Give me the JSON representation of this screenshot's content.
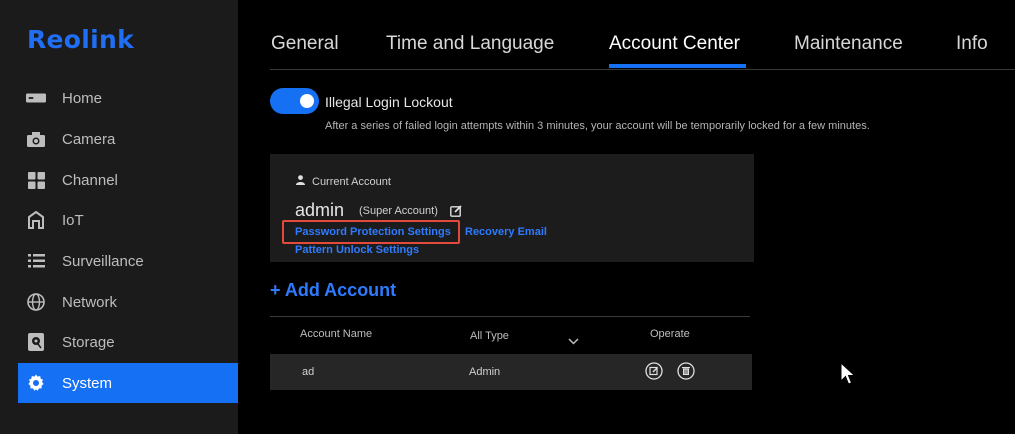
{
  "brand": {
    "logo": "Reolink",
    "accent": "#1670f4"
  },
  "sidebar": {
    "items": [
      {
        "label": "Home",
        "icon": "nvr-device-icon"
      },
      {
        "label": "Camera",
        "icon": "camera-icon"
      },
      {
        "label": "Channel",
        "icon": "grid-icon"
      },
      {
        "label": "IoT",
        "icon": "house-icon"
      },
      {
        "label": "Surveillance",
        "icon": "list-icon"
      },
      {
        "label": "Network",
        "icon": "globe-icon"
      },
      {
        "label": "Storage",
        "icon": "storage-icon"
      },
      {
        "label": "System",
        "icon": "gear-icon",
        "active": true
      }
    ]
  },
  "tabs": [
    {
      "label": "General"
    },
    {
      "label": "Time and Language"
    },
    {
      "label": "Account Center",
      "active": true
    },
    {
      "label": "Maintenance"
    },
    {
      "label": "Info"
    }
  ],
  "lockout": {
    "label": "Illegal Login Lockout",
    "enabled": true,
    "description": "After a series of failed login attempts within 3 minutes, your account will be temporarily locked for a few minutes."
  },
  "current_account": {
    "section_label": "Current Account",
    "name": "admin",
    "role": "(Super Account)",
    "links": {
      "password_protection": "Password Protection Settings",
      "recovery_email": "Recovery Email",
      "pattern_unlock": "Pattern Unlock Settings"
    }
  },
  "add_account_label": "+ Add Account",
  "table": {
    "headers": {
      "name": "Account Name",
      "type": "All Type",
      "operate": "Operate"
    },
    "rows": [
      {
        "name": "ad",
        "type": "Admin"
      }
    ]
  }
}
